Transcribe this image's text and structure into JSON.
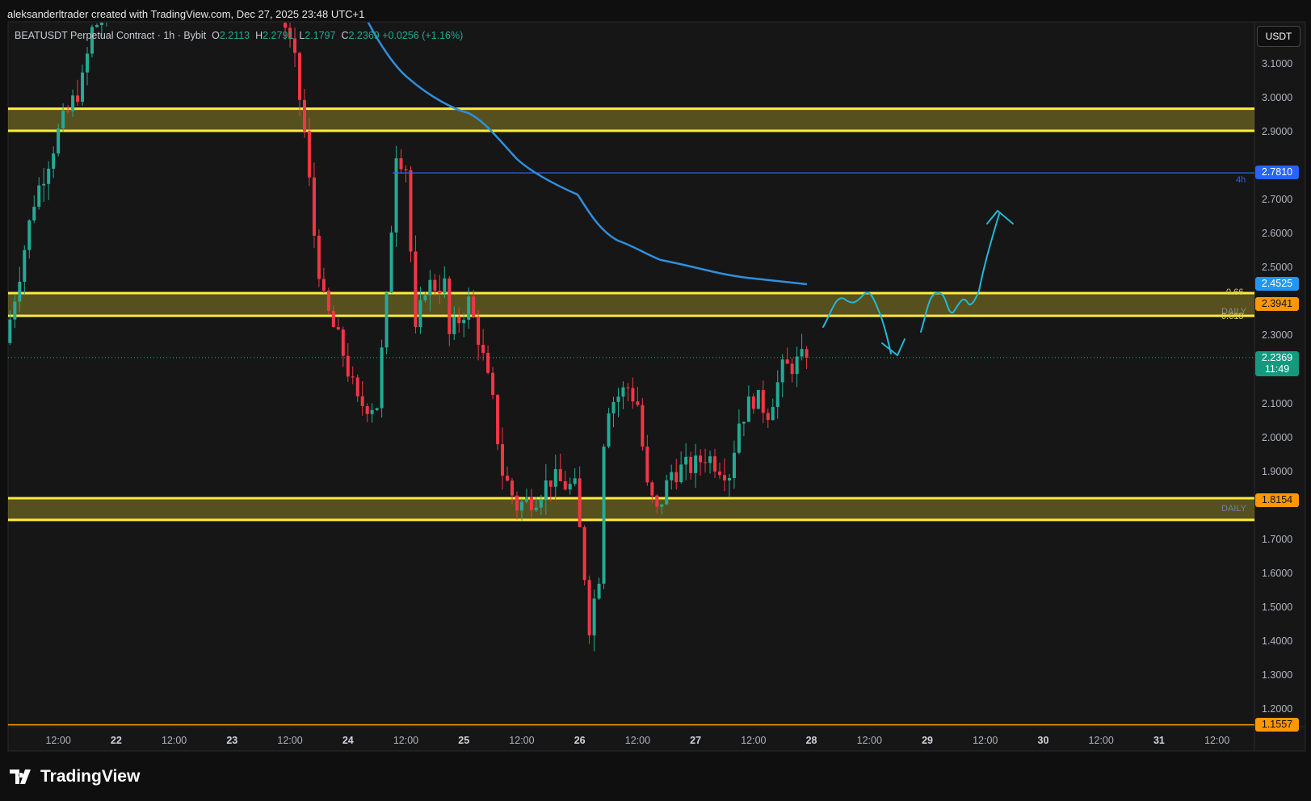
{
  "attribution": "aleksanderltrader created with TradingView.com, Dec 27, 2025 23:48 UTC+1",
  "legend": {
    "symbol": "BEATUSDT Perpetual Contract · 1h · Bybit",
    "o_label": "O",
    "o": "2.2113",
    "h_label": "H",
    "h": "2.2791",
    "l_label": "L",
    "l": "2.1797",
    "c_label": "C",
    "c": "2.2369",
    "change": "+0.0256 (+1.16%)"
  },
  "currency": "USDT",
  "price_axis": [
    "3.1000",
    "3.0000",
    "2.9000",
    "2.7000",
    "2.6000",
    "2.5000",
    "2.3000",
    "2.1000",
    "2.0000",
    "1.9000",
    "1.7000",
    "1.6000",
    "1.5000",
    "1.4000",
    "1.3000",
    "1.2000"
  ],
  "price_labels": {
    "blue_level": "2.7810",
    "ma": "2.4525",
    "zone": "2.3941",
    "last": "2.2369",
    "countdown": "11:49",
    "support": "1.8154",
    "bottom": "1.1557"
  },
  "notes": {
    "tf4h": "4h",
    "daily1": "DAILY",
    "fib1": "0.66",
    "fib2": "0.618",
    "daily2": "DAILY"
  },
  "time_axis": [
    {
      "t": "12:00",
      "h": -12
    },
    {
      "t": "22",
      "h": 0,
      "day": true
    },
    {
      "t": "12:00",
      "h": 12
    },
    {
      "t": "23",
      "h": 24,
      "day": true
    },
    {
      "t": "12:00",
      "h": 36
    },
    {
      "t": "24",
      "h": 48,
      "day": true
    },
    {
      "t": "12:00",
      "h": 60
    },
    {
      "t": "25",
      "h": 72,
      "day": true
    },
    {
      "t": "12:00",
      "h": 84
    },
    {
      "t": "26",
      "h": 96,
      "day": true
    },
    {
      "t": "12:00",
      "h": 108
    },
    {
      "t": "27",
      "h": 120,
      "day": true
    },
    {
      "t": "12:00",
      "h": 132
    },
    {
      "t": "28",
      "h": 144,
      "day": true
    },
    {
      "t": "12:00",
      "h": 156
    },
    {
      "t": "29",
      "h": 168,
      "day": true
    },
    {
      "t": "12:00",
      "h": 180
    },
    {
      "t": "30",
      "h": 192,
      "day": true
    },
    {
      "t": "12:00",
      "h": 204
    },
    {
      "t": "31",
      "h": 216,
      "day": true
    },
    {
      "t": "12:00",
      "h": 228
    }
  ],
  "zones": [
    [
      2.905,
      2.97
    ],
    [
      2.36,
      2.427
    ],
    [
      1.759,
      1.823
    ]
  ],
  "levels": {
    "blue": 2.781,
    "last": 2.2369,
    "bottom": 1.1557
  },
  "colors": {
    "up": "#22ab94",
    "down": "#f23645",
    "zone": "#ffeb3b",
    "ma": "#2f8fdd",
    "arrow": "#22b8d6",
    "level": "#2962ff",
    "orange": "#ff9800"
  },
  "price_path": [
    [
      -22,
      2.35
    ],
    [
      -17,
      2.7
    ],
    [
      -12,
      2.9
    ],
    [
      -7,
      3.05
    ],
    [
      -5,
      3.2
    ],
    [
      10,
      3.5
    ],
    [
      30,
      3.5
    ],
    [
      37,
      3.1
    ],
    [
      39,
      2.9
    ],
    [
      41,
      2.6
    ],
    [
      43,
      2.4
    ],
    [
      47,
      2.25
    ],
    [
      50,
      2.1
    ],
    [
      54,
      2.1
    ],
    [
      56,
      2.4
    ],
    [
      58,
      2.85
    ],
    [
      60,
      2.8
    ],
    [
      62,
      2.3
    ],
    [
      64,
      2.45
    ],
    [
      68,
      2.45
    ],
    [
      69,
      2.3
    ],
    [
      73,
      2.4
    ],
    [
      75,
      2.3
    ],
    [
      78,
      2.1
    ],
    [
      80,
      1.9
    ],
    [
      83,
      1.8
    ],
    [
      87,
      1.83
    ],
    [
      90,
      1.88
    ],
    [
      95,
      1.85
    ],
    [
      97,
      1.6
    ],
    [
      98,
      1.45
    ],
    [
      100,
      1.6
    ],
    [
      101,
      2.0
    ],
    [
      102,
      2.1
    ],
    [
      106,
      2.15
    ],
    [
      108,
      2.1
    ],
    [
      110,
      1.85
    ],
    [
      112,
      1.78
    ],
    [
      115,
      1.9
    ],
    [
      120,
      1.92
    ],
    [
      122,
      1.95
    ],
    [
      127,
      1.9
    ],
    [
      129,
      2.05
    ],
    [
      132,
      2.12
    ],
    [
      135,
      2.08
    ],
    [
      138,
      2.2
    ],
    [
      143,
      2.2369
    ]
  ]
}
